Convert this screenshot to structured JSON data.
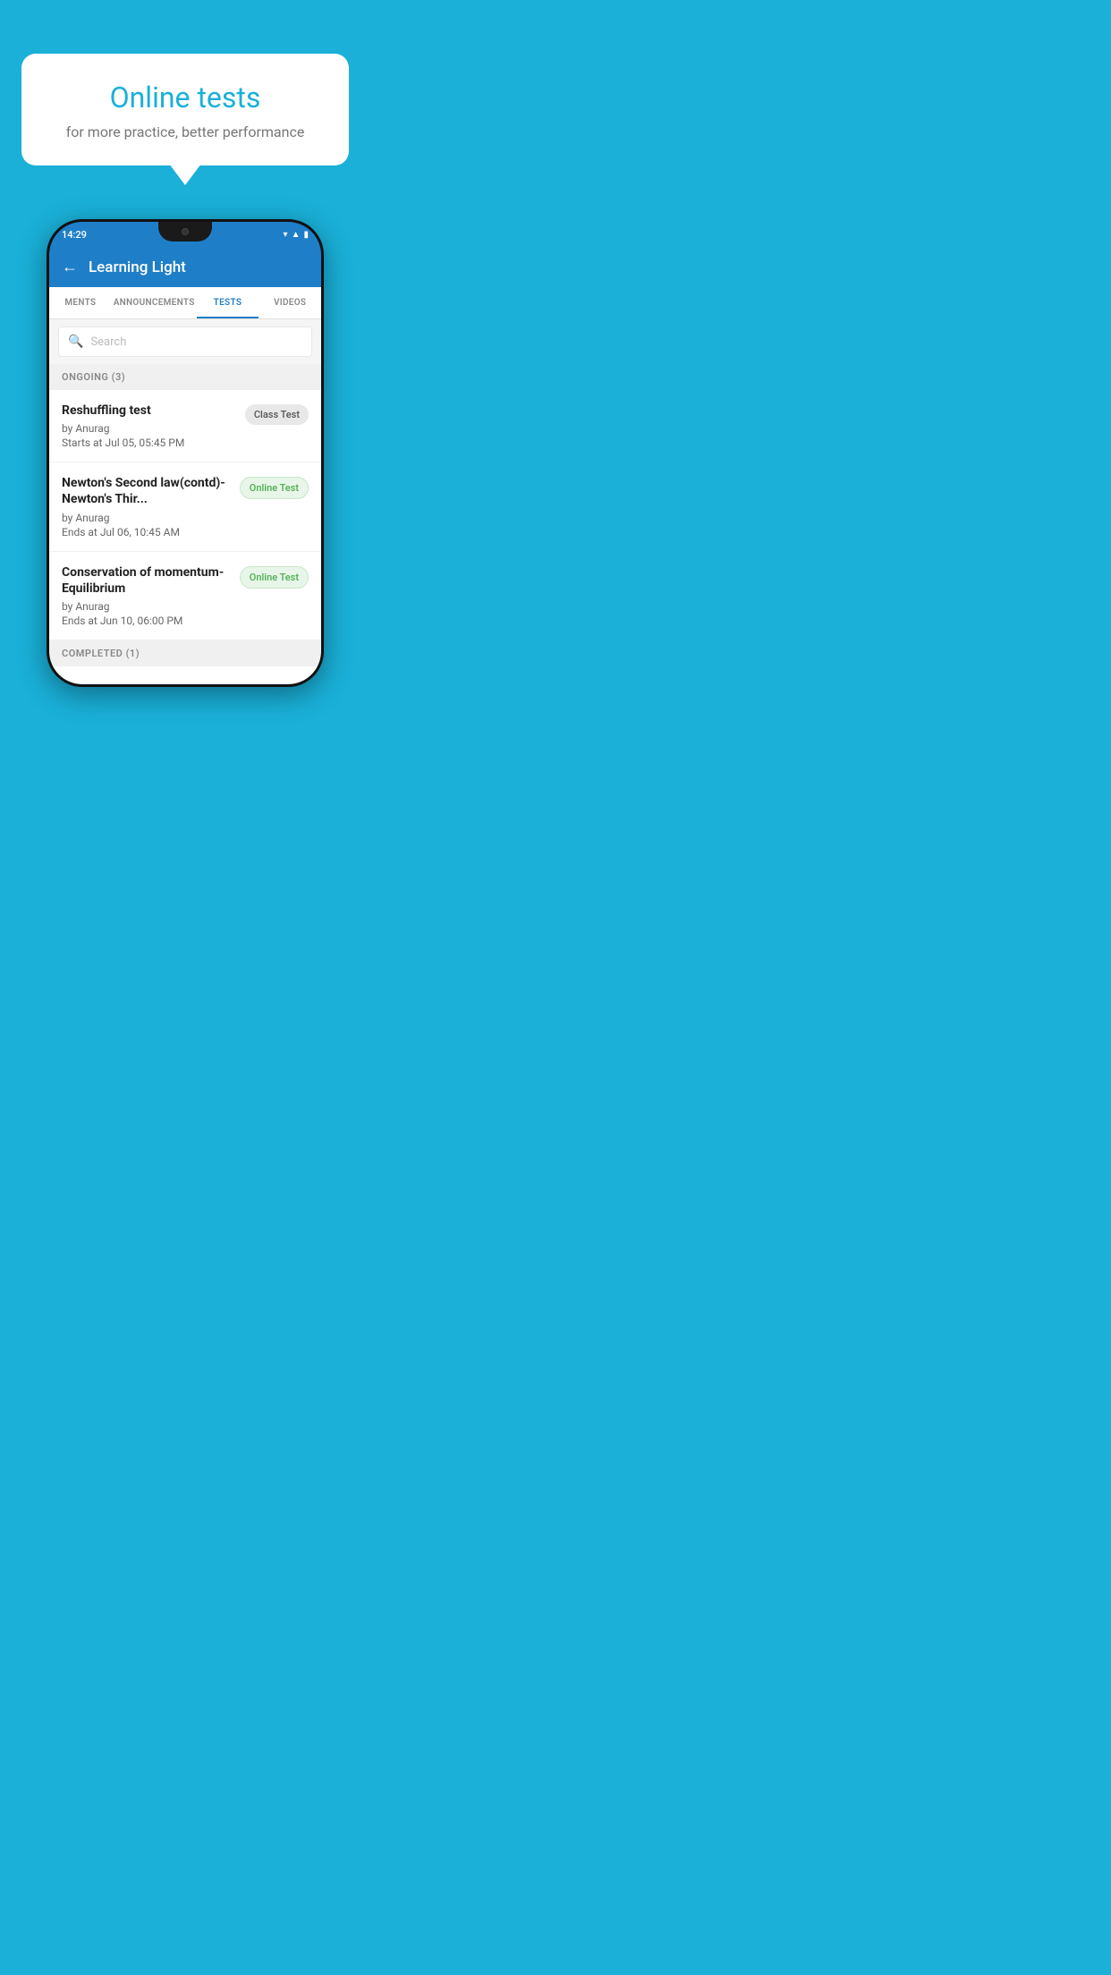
{
  "background_color": "#1ab0d8",
  "speech_bubble": {
    "title": "Online tests",
    "subtitle": "for more practice, better performance"
  },
  "phone": {
    "status_bar": {
      "time": "14:29",
      "icons": [
        "wifi",
        "signal",
        "battery"
      ]
    },
    "header": {
      "title": "Learning Light",
      "back_label": "←"
    },
    "tabs": [
      {
        "label": "MENTS",
        "active": false
      },
      {
        "label": "ANNOUNCEMENTS",
        "active": false
      },
      {
        "label": "TESTS",
        "active": true
      },
      {
        "label": "VIDEOS",
        "active": false
      }
    ],
    "search": {
      "placeholder": "Search"
    },
    "ongoing_section": {
      "label": "ONGOING (3)"
    },
    "tests": [
      {
        "name": "Reshuffling test",
        "by": "by Anurag",
        "date": "Starts at  Jul 05, 05:45 PM",
        "badge": "Class Test",
        "badge_type": "class"
      },
      {
        "name": "Newton's Second law(contd)-Newton's Thir...",
        "by": "by Anurag",
        "date": "Ends at  Jul 06, 10:45 AM",
        "badge": "Online Test",
        "badge_type": "online"
      },
      {
        "name": "Conservation of momentum-Equilibrium",
        "by": "by Anurag",
        "date": "Ends at  Jun 10, 06:00 PM",
        "badge": "Online Test",
        "badge_type": "online"
      }
    ],
    "completed_section": {
      "label": "COMPLETED (1)"
    }
  }
}
